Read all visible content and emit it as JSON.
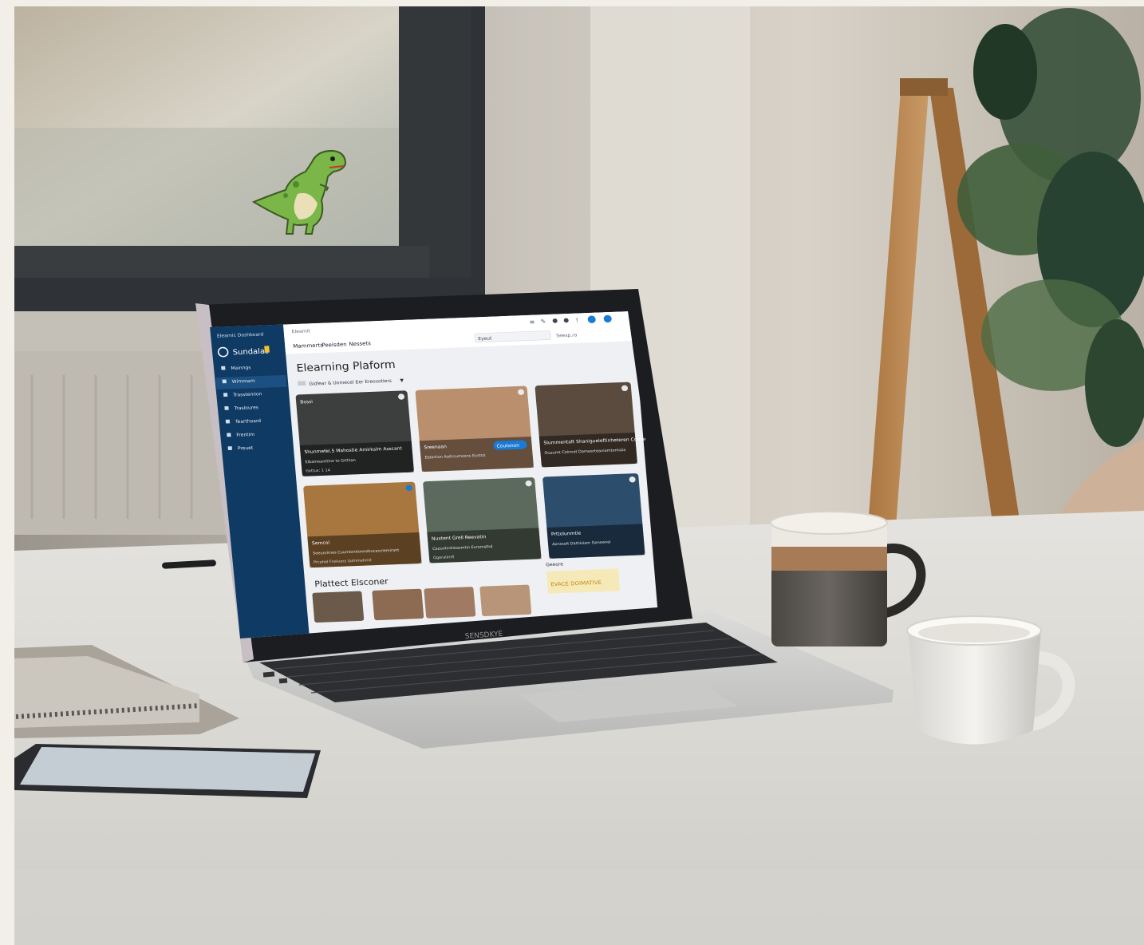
{
  "screen": {
    "sidebar": {
      "header": "Elearnic Dashboard",
      "brand": "Sundalat",
      "items": [
        {
          "label": "Mainngs",
          "icon": "home-icon"
        },
        {
          "label": "Wimmarn",
          "icon": "book-icon"
        },
        {
          "label": "Trasstemion",
          "icon": "file-icon"
        },
        {
          "label": "Trasloures",
          "icon": "gear-icon"
        },
        {
          "label": "Tearthoard",
          "icon": "bookmark-icon"
        },
        {
          "label": "Frentim",
          "icon": "user-icon"
        },
        {
          "label": "Preuet",
          "icon": "globe-icon"
        }
      ]
    },
    "header": {
      "breadcrumb": "Elearnit",
      "tabs": [
        "Mammerts",
        "Peeisden",
        "Nessets"
      ],
      "search_label": "Eyeut",
      "search_placeholder": "Seesp.ra"
    },
    "page_title": "Elearning Plaform",
    "filter_label": "Gidlear & Uomecel Eer Ereosotiers",
    "cards": [
      {
        "badge": "Bossi",
        "title": "Shunmefel.5 Mahostie Amirkslm Asscant",
        "subtitle": "Elbameanttine to Grthlan",
        "meta": "tlottus: 1 14"
      },
      {
        "title": "Sreenaan",
        "subtitle": "Eblartion Aaitrcumsens Eustoz",
        "button": "Coutsnon"
      },
      {
        "title": "Slummentaft Shanigueleftinheteren Comarmst",
        "subtitle": "Ouaumt Coinnot Dameerteaniamtemiaia"
      },
      {
        "title": "Semcol",
        "subtitle": "Soeunrimes Cuumionitonnobucanclemirant",
        "meta": "Prcahel Fnelvers taimmelimit"
      },
      {
        "title": "Nuxtent Grell Reevatin",
        "subtitle": "Caounhrelieasmtin Exromsthd",
        "meta": "Ogerallrnfl"
      },
      {
        "title": "Prttolunmtie",
        "subtitle": "Aonssolt Dathisiam Goneenel"
      }
    ],
    "section_title": "Plattect Elsconer",
    "promo_label": "Geeore",
    "promo_text": "EVACE DOIMATIVE"
  },
  "laptop_brand": "SENSDKYE"
}
